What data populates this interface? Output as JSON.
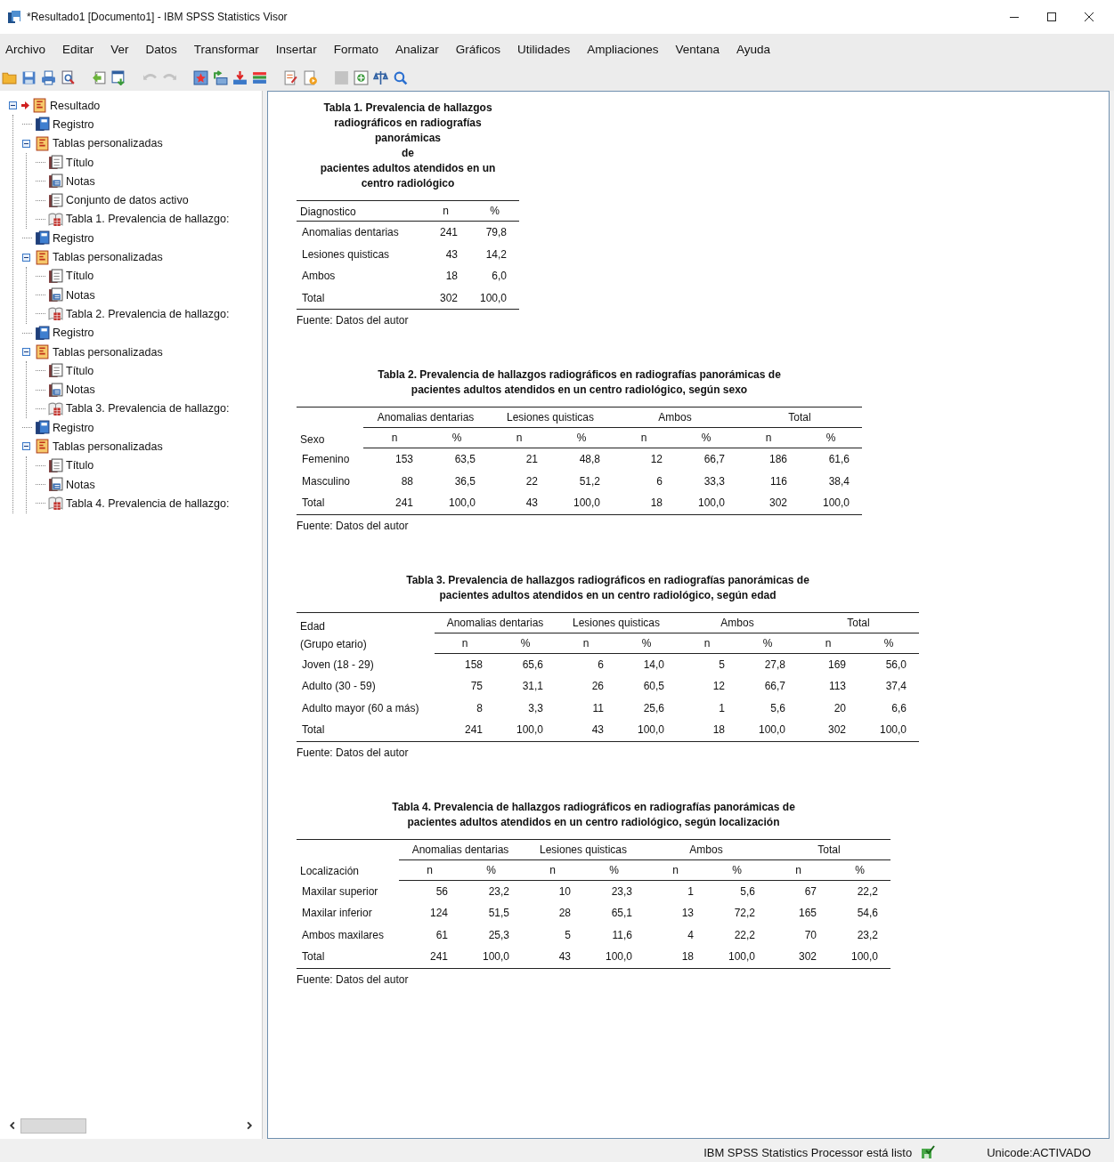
{
  "window": {
    "title": "*Resultado1 [Documento1] - IBM SPSS Statistics Visor"
  },
  "menu": [
    "Archivo",
    "Editar",
    "Ver",
    "Datos",
    "Transformar",
    "Insertar",
    "Formato",
    "Analizar",
    "Gráficos",
    "Utilidades",
    "Ampliaciones",
    "Ventana",
    "Ayuda"
  ],
  "toolbar": [
    {
      "kind": "open",
      "disabled": false
    },
    {
      "kind": "save",
      "disabled": false
    },
    {
      "kind": "print",
      "disabled": false
    },
    {
      "kind": "preview",
      "disabled": false
    },
    {
      "kind": "export",
      "disabled": false
    },
    {
      "kind": "recall",
      "disabled": false
    },
    {
      "kind": "undo",
      "disabled": true
    },
    {
      "kind": "redo",
      "disabled": true
    },
    {
      "kind": "goto-data",
      "disabled": false
    },
    {
      "kind": "goto-case",
      "disabled": false
    },
    {
      "kind": "goto-variable",
      "disabled": false
    },
    {
      "kind": "variables",
      "disabled": false
    },
    {
      "kind": "edit-doc",
      "disabled": false
    },
    {
      "kind": "run-doc",
      "disabled": false
    },
    {
      "kind": "block",
      "disabled": true
    },
    {
      "kind": "insert",
      "disabled": false
    },
    {
      "kind": "balance",
      "disabled": false
    },
    {
      "kind": "search",
      "disabled": false
    }
  ],
  "outline": [
    {
      "kind": "group",
      "label": "Resultado",
      "expanded": true,
      "current": true,
      "children": [
        {
          "kind": "log",
          "label": "Registro",
          "current": false
        },
        {
          "kind": "group",
          "label": "Tablas personalizadas",
          "expanded": true,
          "current": false,
          "children": [
            {
              "kind": "title",
              "label": "Título",
              "current": false
            },
            {
              "kind": "notes",
              "label": "Notas",
              "current": false
            },
            {
              "kind": "dataset",
              "label": "Conjunto de datos activo",
              "current": false
            },
            {
              "kind": "table",
              "label": "Tabla 1. Prevalencia de hallazgo:",
              "current": false
            }
          ]
        },
        {
          "kind": "log",
          "label": "Registro",
          "current": false
        },
        {
          "kind": "group",
          "label": "Tablas personalizadas",
          "expanded": true,
          "current": false,
          "children": [
            {
              "kind": "title",
              "label": "Título",
              "current": false
            },
            {
              "kind": "notes",
              "label": "Notas",
              "current": false
            },
            {
              "kind": "table",
              "label": "Tabla 2. Prevalencia de hallazgo:",
              "current": false
            }
          ]
        },
        {
          "kind": "log",
          "label": "Registro",
          "current": false
        },
        {
          "kind": "group",
          "label": "Tablas personalizadas",
          "expanded": true,
          "current": false,
          "children": [
            {
              "kind": "title",
              "label": "Título",
              "current": false
            },
            {
              "kind": "notes",
              "label": "Notas",
              "current": false
            },
            {
              "kind": "table",
              "label": "Tabla 3. Prevalencia de hallazgo:",
              "current": false
            }
          ]
        },
        {
          "kind": "log",
          "label": "Registro",
          "current": false
        },
        {
          "kind": "group",
          "label": "Tablas personalizadas",
          "expanded": true,
          "current": false,
          "children": [
            {
              "kind": "title",
              "label": "Título",
              "current": false
            },
            {
              "kind": "notes",
              "label": "Notas",
              "current": false
            },
            {
              "kind": "table",
              "label": "Tabla 4. Prevalencia de hallazgo:",
              "current": false
            }
          ]
        }
      ]
    }
  ],
  "tables": [
    {
      "title": "Tabla 1. Prevalencia de hallazgos radiográficos en radiografías panorámicas\nde\npacientes adultos atendidos en un centro radiológico",
      "stub": "Diagnostico",
      "columns": [
        "n",
        "%"
      ],
      "rows": [
        {
          "label": "Anomalias dentarias",
          "cells": [
            "241",
            "79,8"
          ]
        },
        {
          "label": "Lesiones quisticas",
          "cells": [
            "43",
            "14,2"
          ]
        },
        {
          "label": "Ambos",
          "cells": [
            "18",
            "6,0"
          ]
        },
        {
          "label": "Total",
          "cells": [
            "302",
            "100,0"
          ]
        }
      ],
      "footnote": "Fuente: Datos del autor"
    },
    {
      "title": "Tabla 2. Prevalencia de hallazgos radiográficos en radiografías panorámicas de\npacientes adultos atendidos en un centro radiológico, según sexo",
      "stub": "Sexo",
      "groups": [
        "Anomalias dentarias",
        "Lesiones quisticas",
        "Ambos",
        "Total"
      ],
      "columns": [
        "n",
        "%",
        "n",
        "%",
        "n",
        "%",
        "n",
        "%"
      ],
      "rows": [
        {
          "label": "Femenino",
          "cells": [
            "153",
            "63,5",
            "21",
            "48,8",
            "12",
            "66,7",
            "186",
            "61,6"
          ]
        },
        {
          "label": "Masculino",
          "cells": [
            "88",
            "36,5",
            "22",
            "51,2",
            "6",
            "33,3",
            "116",
            "38,4"
          ]
        },
        {
          "label": "Total",
          "cells": [
            "241",
            "100,0",
            "43",
            "100,0",
            "18",
            "100,0",
            "302",
            "100,0"
          ]
        }
      ],
      "footnote": "Fuente: Datos del autor"
    },
    {
      "title": "Tabla 3. Prevalencia de hallazgos radiográficos en radiografías panorámicas de\npacientes adultos atendidos en un centro radiológico, según edad",
      "stub": "Edad\n(Grupo etario)",
      "groups": [
        "Anomalias dentarias",
        "Lesiones quisticas",
        "Ambos",
        "Total"
      ],
      "columns": [
        "n",
        "%",
        "n",
        "%",
        "n",
        "%",
        "n",
        "%"
      ],
      "rows": [
        {
          "label": "Joven (18 - 29)",
          "cells": [
            "158",
            "65,6",
            "6",
            "14,0",
            "5",
            "27,8",
            "169",
            "56,0"
          ]
        },
        {
          "label": "Adulto (30 - 59)",
          "cells": [
            "75",
            "31,1",
            "26",
            "60,5",
            "12",
            "66,7",
            "113",
            "37,4"
          ]
        },
        {
          "label": "Adulto mayor (60  a más)",
          "cells": [
            "8",
            "3,3",
            "11",
            "25,6",
            "1",
            "5,6",
            "20",
            "6,6"
          ]
        },
        {
          "label": "Total",
          "cells": [
            "241",
            "100,0",
            "43",
            "100,0",
            "18",
            "100,0",
            "302",
            "100,0"
          ]
        }
      ],
      "footnote": "Fuente: Datos del autor"
    },
    {
      "title": "Tabla 4. Prevalencia de hallazgos radiográficos en radiografías panorámicas de\npacientes adultos atendidos en un centro radiológico, según localización",
      "stub": "Localización",
      "groups": [
        "Anomalias dentarias",
        "Lesiones quisticas",
        "Ambos",
        "Total"
      ],
      "columns": [
        "n",
        "%",
        "n",
        "%",
        "n",
        "%",
        "n",
        "%"
      ],
      "rows": [
        {
          "label": "Maxilar superior",
          "cells": [
            "56",
            "23,2",
            "10",
            "23,3",
            "1",
            "5,6",
            "67",
            "22,2"
          ]
        },
        {
          "label": "Maxilar inferior",
          "cells": [
            "124",
            "51,5",
            "28",
            "65,1",
            "13",
            "72,2",
            "165",
            "54,6"
          ]
        },
        {
          "label": "Ambos maxilares",
          "cells": [
            "61",
            "25,3",
            "5",
            "11,6",
            "4",
            "22,2",
            "70",
            "23,2"
          ]
        },
        {
          "label": "Total",
          "cells": [
            "241",
            "100,0",
            "43",
            "100,0",
            "18",
            "100,0",
            "302",
            "100,0"
          ]
        }
      ],
      "footnote": "Fuente: Datos del autor"
    }
  ],
  "status_bar": {
    "message": "IBM SPSS Statistics Processor está listo",
    "encoding": "Unicode:ACTIVADO"
  }
}
